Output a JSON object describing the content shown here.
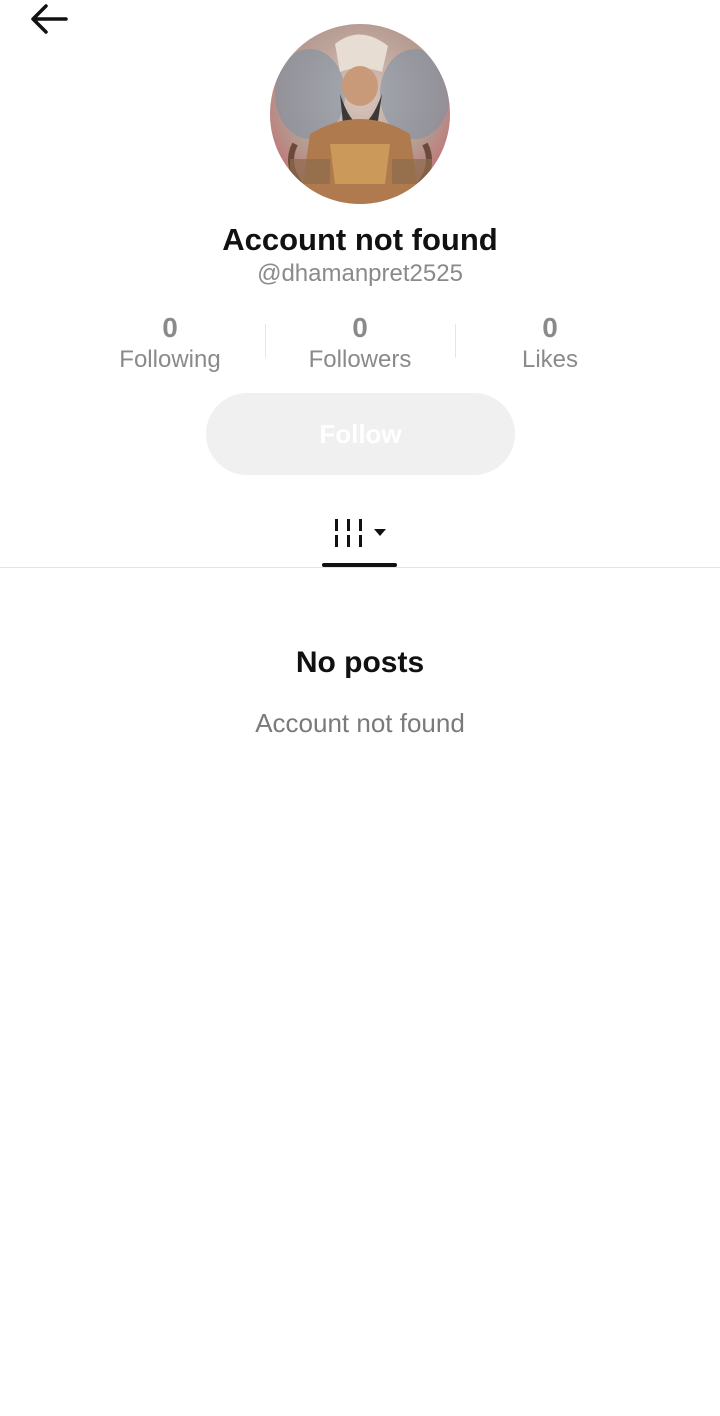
{
  "header": {
    "back_icon": "arrow-left-icon"
  },
  "profile": {
    "title": "Account not found",
    "handle": "@dhamanpret2525"
  },
  "stats": [
    {
      "value": "0",
      "label": "Following"
    },
    {
      "value": "0",
      "label": "Followers"
    },
    {
      "value": "0",
      "label": "Likes"
    }
  ],
  "follow_button": {
    "label": "Follow"
  },
  "tabs": {
    "videos_icon": "grid-icon",
    "dropdown_icon": "caret-down-icon"
  },
  "empty_state": {
    "title": "No posts",
    "subtitle": "Account not found"
  },
  "colors": {
    "text_primary": "#111111",
    "text_secondary": "#8a8a8a",
    "button_disabled_bg": "#f0f0f0"
  }
}
